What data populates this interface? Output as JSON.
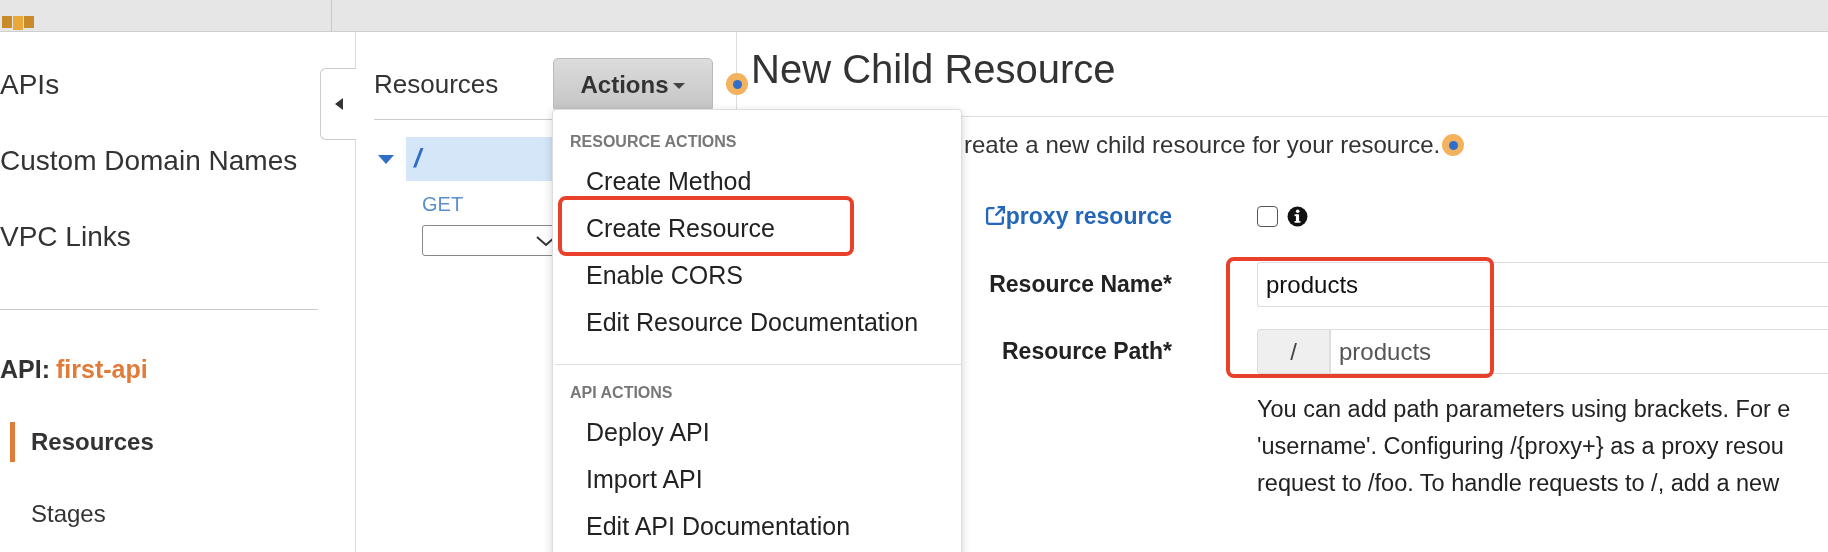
{
  "sidebar": {
    "items": [
      {
        "label": "APIs"
      },
      {
        "label": "Custom Domain Names"
      },
      {
        "label": "VPC Links"
      }
    ],
    "api_label": "API:",
    "api_name": "first-api",
    "api_items": [
      {
        "label": "Resources",
        "selected": true
      },
      {
        "label": "Stages",
        "selected": false
      }
    ]
  },
  "resources_panel": {
    "title": "Resources",
    "actions_button": "Actions",
    "tree": [
      {
        "path": "/",
        "selected": true,
        "expanded": true,
        "children": [
          {
            "method": "GET"
          }
        ]
      }
    ]
  },
  "actions_menu": {
    "sections": [
      {
        "heading": "RESOURCE ACTIONS",
        "items": [
          {
            "label": "Create Method",
            "highlighted": false
          },
          {
            "label": "Create Resource",
            "highlighted": true
          },
          {
            "label": "Enable CORS",
            "highlighted": false
          },
          {
            "label": "Edit Resource Documentation",
            "highlighted": false
          }
        ]
      },
      {
        "heading": "API ACTIONS",
        "items": [
          {
            "label": "Deploy API",
            "highlighted": false
          },
          {
            "label": "Import API",
            "highlighted": false
          },
          {
            "label": "Edit API Documentation",
            "highlighted": false
          }
        ]
      }
    ]
  },
  "main": {
    "title": "New Child Resource",
    "intro": "reate a new child resource for your resource.",
    "proxy": {
      "label": "proxy resource",
      "checked": false
    },
    "fields": [
      {
        "label": "Resource Name*",
        "value": "products"
      },
      {
        "label": "Resource Path*",
        "prefix": "/",
        "value": "products"
      }
    ],
    "fields_highlighted": true,
    "help_lines": [
      "You can add path parameters using brackets. For e",
      "'username'. Configuring /{proxy+} as a proxy resou",
      "request to /foo. To handle requests to /, add a new"
    ]
  }
}
